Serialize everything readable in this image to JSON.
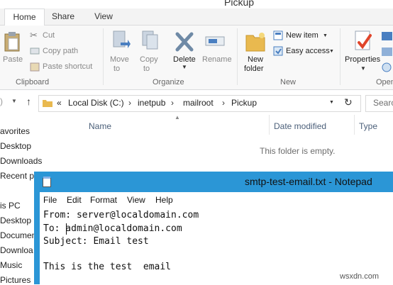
{
  "explorer": {
    "title": "Pickup",
    "tabs": [
      "Home",
      "Share",
      "View"
    ],
    "ribbon": {
      "clipboard": {
        "paste": "Paste",
        "cut": "Cut",
        "copy_path": "Copy path",
        "paste_shortcut": "Paste shortcut",
        "group": "Clipboard"
      },
      "organize": {
        "move_to": "Move",
        "move_to2": "to",
        "copy_to": "Copy",
        "copy_to2": "to",
        "delete": "Delete",
        "rename": "Rename",
        "group": "Organize"
      },
      "new": {
        "new_folder": "New",
        "new_folder2": "folder",
        "new_item": "New item",
        "easy_access": "Easy access",
        "group": "New"
      },
      "open": {
        "properties": "Properties",
        "group": "Open"
      }
    },
    "address": {
      "prefix": "«",
      "crumbs": [
        "Local Disk (C:)",
        "inetpub",
        "mailroot",
        "Pickup"
      ],
      "search_placeholder": "Searc"
    },
    "nav": [
      "avorites",
      "Desktop",
      "Downloads",
      "Recent p",
      "is PC",
      "Desktop",
      "Documen",
      "Downloa",
      "Music",
      "Pictures"
    ],
    "columns": [
      "Name",
      "Date modified",
      "Type"
    ],
    "empty_text": "This folder is empty."
  },
  "notepad": {
    "title": "smtp-test-email.txt - Notepad",
    "menu": [
      "File",
      "Edit",
      "Format",
      "View",
      "Help"
    ],
    "lines": [
      "From: server@localdomain.com",
      "To: admin@localdomain.com",
      "Subject: Email test",
      "",
      "This is the test  email"
    ]
  },
  "watermark": "wsxdn.com"
}
